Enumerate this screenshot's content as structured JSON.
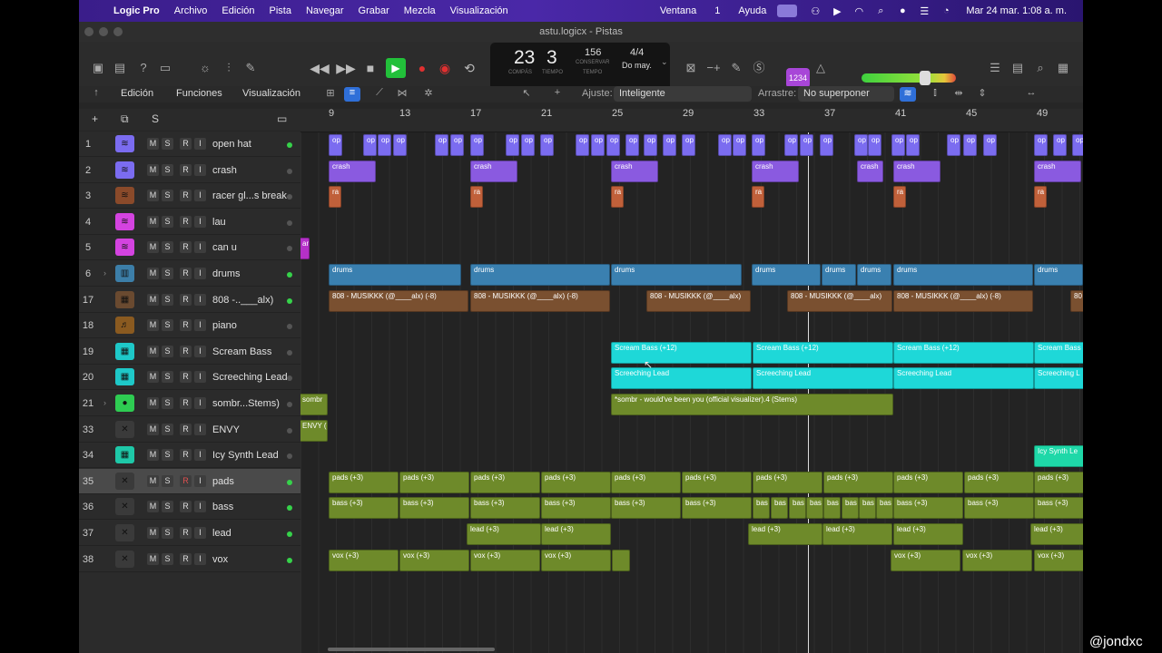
{
  "menubar": {
    "app": "Logic Pro",
    "items": [
      "Archivo",
      "Edición",
      "Pista",
      "Navegar",
      "Grabar",
      "Mezcla",
      "Visualización"
    ],
    "right": [
      "Ventana",
      "1",
      "Ayuda"
    ],
    "clock": "Mar 24 mar.  1:08 a. m."
  },
  "window": {
    "title": "astu.logicx - Pistas"
  },
  "lcd": {
    "bar": "23",
    "beat": "3",
    "bar_label": "COMPÁS",
    "beat_label": "TIEMPO",
    "tempo": "156",
    "tempo_mode": "CONSERVAR",
    "tempo_label": "TEMPO",
    "signature": "4/4",
    "key": "Do may."
  },
  "controlbar": {
    "btn1234": "1234"
  },
  "edit_toolbar": {
    "edicion": "Edición",
    "funciones": "Funciones",
    "visualizacion": "Visualización",
    "snap_label": "Ajuste:",
    "snap_value": "Inteligente",
    "drag_label": "Arrastre:",
    "drag_value": "No superponer"
  },
  "header_tools": {
    "add": "+",
    "dup": "⧉",
    "s": "S"
  },
  "ruler": [
    "9",
    "13",
    "17",
    "21",
    "25",
    "29",
    "33",
    "37",
    "41",
    "45",
    "49"
  ],
  "tracks": [
    {
      "num": "1",
      "name": "open hat",
      "color": "#7b6cf0",
      "icon": "waveform-icon",
      "active": true
    },
    {
      "num": "2",
      "name": "crash",
      "color": "#7b6cf0",
      "icon": "waveform-icon",
      "active": false
    },
    {
      "num": "3",
      "name": "racer gl...s break",
      "color": "#8a4a2a",
      "icon": "waveform-icon",
      "active": false
    },
    {
      "num": "4",
      "name": "lau",
      "color": "#d443e0",
      "icon": "waveform-icon",
      "active": false
    },
    {
      "num": "5",
      "name": "can u",
      "color": "#d443e0",
      "icon": "waveform-icon",
      "active": false
    },
    {
      "num": "6",
      "name": "drums",
      "color": "#3c7ea8",
      "icon": "drum-machine-icon",
      "active": true,
      "folder": true
    },
    {
      "num": "17",
      "name": "808 -..___alx)",
      "color": "#6a4a30",
      "icon": "keyboard-icon",
      "active": true
    },
    {
      "num": "18",
      "name": "piano",
      "color": "#8a5a20",
      "icon": "piano-icon",
      "active": false
    },
    {
      "num": "19",
      "name": "Scream Bass",
      "color": "#1ec8c8",
      "icon": "keyboard-icon",
      "active": false
    },
    {
      "num": "20",
      "name": "Screeching Lead",
      "color": "#1ec8c8",
      "icon": "keyboard-icon",
      "active": false
    },
    {
      "num": "21",
      "name": "sombr...Stems)",
      "color": "#2ecc52",
      "icon": "stems-icon",
      "active": false,
      "folder": true
    },
    {
      "num": "33",
      "name": "ENVY",
      "color": "#3a3a3a",
      "icon": "crossed-sticks-icon",
      "active": false
    },
    {
      "num": "34",
      "name": "Icy Synth Lead",
      "color": "#1ec8a8",
      "icon": "keyboard-icon",
      "active": false
    },
    {
      "num": "35",
      "name": "pads",
      "color": "#3a3a3a",
      "icon": "crossed-sticks-icon",
      "active": true,
      "selected": true
    },
    {
      "num": "36",
      "name": "bass",
      "color": "#3a3a3a",
      "icon": "crossed-sticks-icon",
      "active": true
    },
    {
      "num": "37",
      "name": "lead",
      "color": "#3a3a3a",
      "icon": "crossed-sticks-icon",
      "active": true
    },
    {
      "num": "38",
      "name": "vox",
      "color": "#3a3a3a",
      "icon": "crossed-sticks-icon",
      "active": true
    }
  ],
  "track_buttons": {
    "m": "M",
    "s": "S",
    "r": "R",
    "i": "I"
  },
  "regions": {
    "openhat": "op",
    "crash": "crash",
    "racer": "ra",
    "can": "an",
    "drums": "drums",
    "bass808": "808 - MUSIKKK (@____alx) (-8)",
    "bass808b": "808 - MUSIKKK (@____alx)",
    "bass808c": "80",
    "scream": "Scream Bass (+12)",
    "screamShort": "Scream Bass",
    "screech": "Screeching Lead",
    "screechShort": "Screeching L",
    "sombr": "sombr",
    "sombrLong": "*sombr - would've been you (official visualizer).4 (Stems)",
    "envy": "ENVY (+",
    "icy": "Icy Synth Le",
    "pads": "pads (+3)",
    "bass": "bass (+3)",
    "bassShort": "bas",
    "lead": "lead (+3)",
    "vox": "vox (+3)"
  },
  "watermark": "@jondxc"
}
